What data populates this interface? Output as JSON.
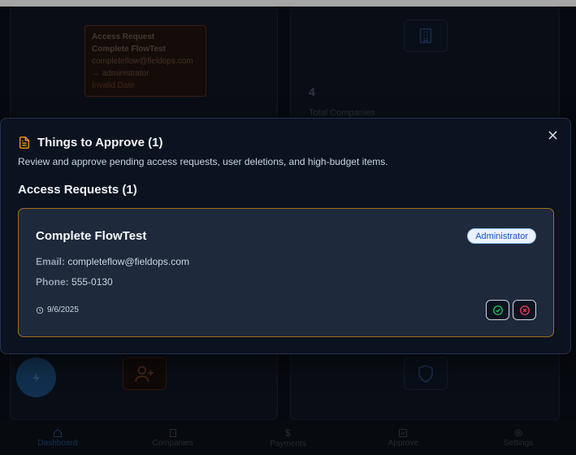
{
  "background": {
    "mini_request": {
      "title": "Access Request",
      "name": "Complete FlowTest",
      "email": "completeflow@fieldops.com",
      "arrow_role": "→ administrator",
      "date_warning": "Invalid Date"
    },
    "stat": {
      "value": "4",
      "label": "Total Companies"
    },
    "nav": [
      {
        "label": "Dashboard",
        "icon": "home-icon"
      },
      {
        "label": "Companies",
        "icon": "building-icon"
      },
      {
        "label": "Payments",
        "icon": "dollar-icon"
      },
      {
        "label": "Approve",
        "icon": "check-square-icon"
      },
      {
        "label": "Settings",
        "icon": "gear-icon"
      }
    ]
  },
  "modal": {
    "title": "Things to Approve (1)",
    "description": "Review and approve pending access requests, user deletions, and high-budget items.",
    "section_title": "Access Requests (1)",
    "requests": [
      {
        "name": "Complete FlowTest",
        "role": "Administrator",
        "email_label": "Email:",
        "email": "completeflow@fieldops.com",
        "phone_label": "Phone:",
        "phone": "555-0130",
        "date": "9/6/2025"
      }
    ]
  },
  "colors": {
    "accent_orange": "#f59e0b",
    "card_border": "#a26c13",
    "approve_green": "#22c55e",
    "reject_red": "#f43f5e",
    "badge_blue": "#1d4ed8"
  }
}
